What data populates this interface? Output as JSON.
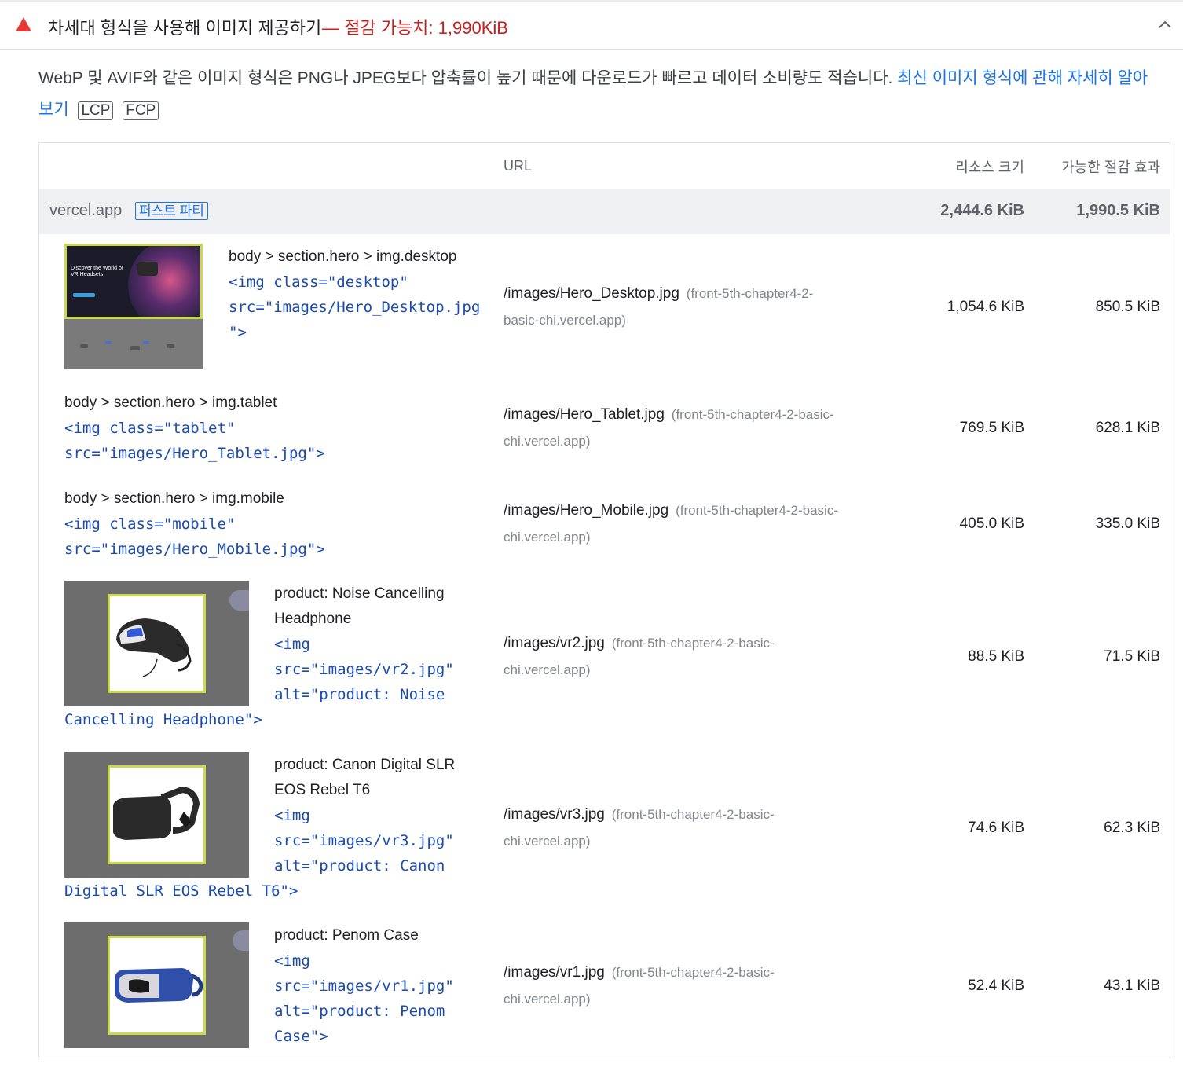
{
  "audit": {
    "title": "차세대 형식을 사용해 이미지 제공하기",
    "savings": "— 절감 가능치: 1,990KiB",
    "description": "WebP 및 AVIF와 같은 이미지 형식은 PNG나 JPEG보다 압축률이 높기 때문에 다운로드가 빠르고 데이터 소비량도 적습니다.",
    "link_text_1": "최신 이미지 형식에 관해 자세히 알아",
    "link_text_2": "보기",
    "metrics": [
      "LCP",
      "FCP"
    ]
  },
  "table": {
    "headers": {
      "url": "URL",
      "resource_size": "리소스 크기",
      "savings": "가능한 절감 효과"
    },
    "group": {
      "name": "vercel.app",
      "badge": "퍼스트 파티",
      "resource_size": "2,444.6 KiB",
      "savings": "1,990.5 KiB"
    },
    "rows": [
      {
        "selector": "body > section.hero > img.desktop",
        "code": [
          "<img class=\"desktop\"",
          "src=\"images/Hero_Desktop.jpg",
          "\">"
        ],
        "url": "/images/Hero_Desktop.jpg",
        "host_1": "(front-5th-chapter4-2-",
        "host_2": "basic-chi.vercel.app)",
        "resource_size": "1,054.6 KiB",
        "savings": "850.5 KiB",
        "thumb_text": "Discover the World of VR Headsets"
      },
      {
        "selector": "body > section.hero > img.tablet",
        "code": [
          "<img class=\"tablet\"",
          "src=\"images/Hero_Tablet.jpg\">"
        ],
        "url": "/images/Hero_Tablet.jpg",
        "host_1": "(front-5th-chapter4-2-basic-",
        "host_2": "chi.vercel.app)",
        "resource_size": "769.5 KiB",
        "savings": "628.1 KiB"
      },
      {
        "selector": "body > section.hero > img.mobile",
        "code": [
          "<img class=\"mobile\"",
          "src=\"images/Hero_Mobile.jpg\">"
        ],
        "url": "/images/Hero_Mobile.jpg",
        "host_1": "(front-5th-chapter4-2-basic-",
        "host_2": "chi.vercel.app)",
        "resource_size": "405.0 KiB",
        "savings": "335.0 KiB"
      },
      {
        "selector_1": "product: Noise Cancelling",
        "selector_2": "Headphone",
        "code": [
          "<img",
          "src=\"images/vr2.jpg\"",
          "alt=\"product: Noise",
          "Cancelling Headphone\">"
        ],
        "url": "/images/vr2.jpg",
        "host_1": "(front-5th-chapter4-2-basic-",
        "host_2": "chi.vercel.app)",
        "resource_size": "88.5 KiB",
        "savings": "71.5 KiB"
      },
      {
        "selector_1": "product: Canon Digital SLR",
        "selector_2": "EOS Rebel T6",
        "code": [
          "<img",
          "src=\"images/vr3.jpg\"",
          "alt=\"product: Canon",
          "Digital SLR EOS Rebel T6\">"
        ],
        "url": "/images/vr3.jpg",
        "host_1": "(front-5th-chapter4-2-basic-",
        "host_2": "chi.vercel.app)",
        "resource_size": "74.6 KiB",
        "savings": "62.3 KiB"
      },
      {
        "selector_1": "product: Penom Case",
        "code": [
          "<img",
          "src=\"images/vr1.jpg\"",
          "alt=\"product: Penom",
          "Case\">"
        ],
        "url": "/images/vr1.jpg",
        "host_1": "(front-5th-chapter4-2-basic-",
        "host_2": "chi.vercel.app)",
        "resource_size": "52.4 KiB",
        "savings": "43.1 KiB"
      }
    ]
  },
  "colors": {
    "warning": "#e53935",
    "link": "#1a73e8",
    "code": "#1a4bb0",
    "group_bg": "#eef0f2",
    "thumb_border": "#c9da4e"
  }
}
